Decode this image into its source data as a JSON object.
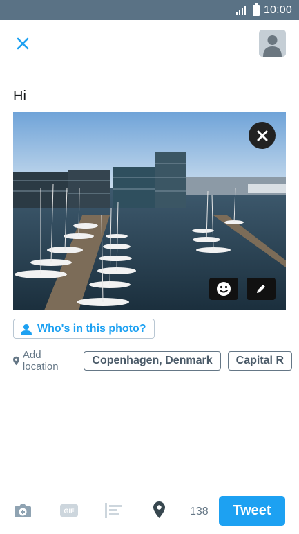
{
  "status_bar": {
    "time": "10:00"
  },
  "compose": {
    "text": "Hi"
  },
  "photo": {
    "tag_label": "Who's in this photo?"
  },
  "location": {
    "add_label": "Add location",
    "suggestions": [
      "Copenhagen, Denmark",
      "Capital R"
    ]
  },
  "toolbar": {
    "char_count": "138",
    "tweet_label": "Tweet"
  },
  "colors": {
    "accent": "#1da1f2",
    "status_bar": "#5a7285",
    "muted": "#657786"
  },
  "icons": [
    "close-icon",
    "avatar-icon",
    "remove-photo-icon",
    "sticker-icon",
    "edit-icon",
    "tag-person-icon",
    "location-pin-icon",
    "camera-icon",
    "gif-icon",
    "poll-icon"
  ]
}
